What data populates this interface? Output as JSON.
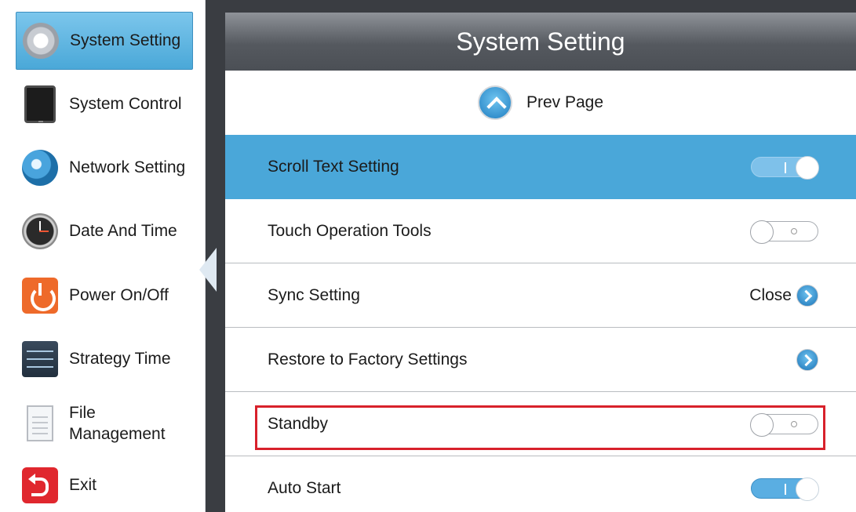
{
  "sidebar": {
    "items": [
      {
        "label": "System Setting",
        "icon": "gear-icon",
        "active": true
      },
      {
        "label": "System Control",
        "icon": "tablet-icon"
      },
      {
        "label": "Network Setting",
        "icon": "globe-icon"
      },
      {
        "label": "Date And Time",
        "icon": "clock-icon"
      },
      {
        "label": "Power On/Off",
        "icon": "power-icon"
      },
      {
        "label": "Strategy Time",
        "icon": "sliders-icon"
      },
      {
        "label_line1": "File",
        "label_line2": "Management",
        "icon": "document-icon"
      },
      {
        "label": "Exit",
        "icon": "exit-icon"
      }
    ]
  },
  "panel": {
    "title": "System Setting",
    "prev_page": "Prev Page",
    "rows": [
      {
        "label": "Scroll Text Setting",
        "control": "toggle",
        "state": "on",
        "highlighted": true
      },
      {
        "label": "Touch Operation Tools",
        "control": "toggle",
        "state": "off"
      },
      {
        "label": "Sync Setting",
        "control": "arrow",
        "value": "Close"
      },
      {
        "label": "Restore to Factory Settings",
        "control": "arrow"
      },
      {
        "label": "Standby",
        "control": "toggle",
        "state": "off",
        "outlined": true
      },
      {
        "label": "Auto Start",
        "control": "toggle",
        "state": "on"
      }
    ]
  },
  "colors": {
    "accent": "#4aa7d9",
    "header": "#55595f",
    "outline": "#d8212b"
  }
}
